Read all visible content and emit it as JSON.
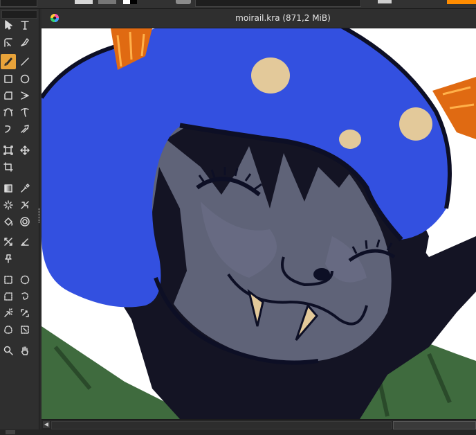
{
  "document": {
    "title": "moirail.kra (871,2 MiB)"
  },
  "toolbox": {
    "tools": [
      {
        "name": "select-shapes-icon"
      },
      {
        "name": "text-icon"
      },
      {
        "name": "edit-shapes-icon"
      },
      {
        "name": "calligraphy-icon"
      },
      {
        "name": "freehand-brush-icon",
        "active": true
      },
      {
        "name": "line-icon"
      },
      {
        "name": "rectangle-icon"
      },
      {
        "name": "ellipse-icon"
      },
      {
        "name": "polygon-icon"
      },
      {
        "name": "polyline-icon"
      },
      {
        "name": "bezier-curve-icon"
      },
      {
        "name": "freehand-path-icon"
      },
      {
        "name": "dynamic-brush-icon"
      },
      {
        "name": "multibrush-icon"
      },
      {
        "name": "transform-icon"
      },
      {
        "name": "move-icon"
      },
      {
        "name": "crop-icon"
      },
      {
        "name": "gradient-icon"
      },
      {
        "name": "color-picker-icon"
      },
      {
        "name": "colorize-mask-icon"
      },
      {
        "name": "smart-patch-icon"
      },
      {
        "name": "fill-icon"
      },
      {
        "name": "enclose-fill-icon"
      },
      {
        "name": "assistant-icon"
      },
      {
        "name": "measure-icon"
      },
      {
        "name": "reference-images-icon"
      },
      {
        "name": "rectangular-select-icon"
      },
      {
        "name": "elliptical-select-icon"
      },
      {
        "name": "polygonal-select-icon"
      },
      {
        "name": "freehand-select-icon"
      },
      {
        "name": "contiguous-select-icon"
      },
      {
        "name": "similar-color-select-icon"
      },
      {
        "name": "bezier-select-icon"
      },
      {
        "name": "magnetic-select-icon"
      },
      {
        "name": "zoom-icon"
      },
      {
        "name": "pan-icon"
      }
    ]
  },
  "colors": {
    "accent": "#e8a33a",
    "panel": "#2f2f2f",
    "hood_blue": "#3350e0",
    "skin": "#5f6378",
    "horn": "#e06a12",
    "jacket": "#3f6b3e"
  }
}
